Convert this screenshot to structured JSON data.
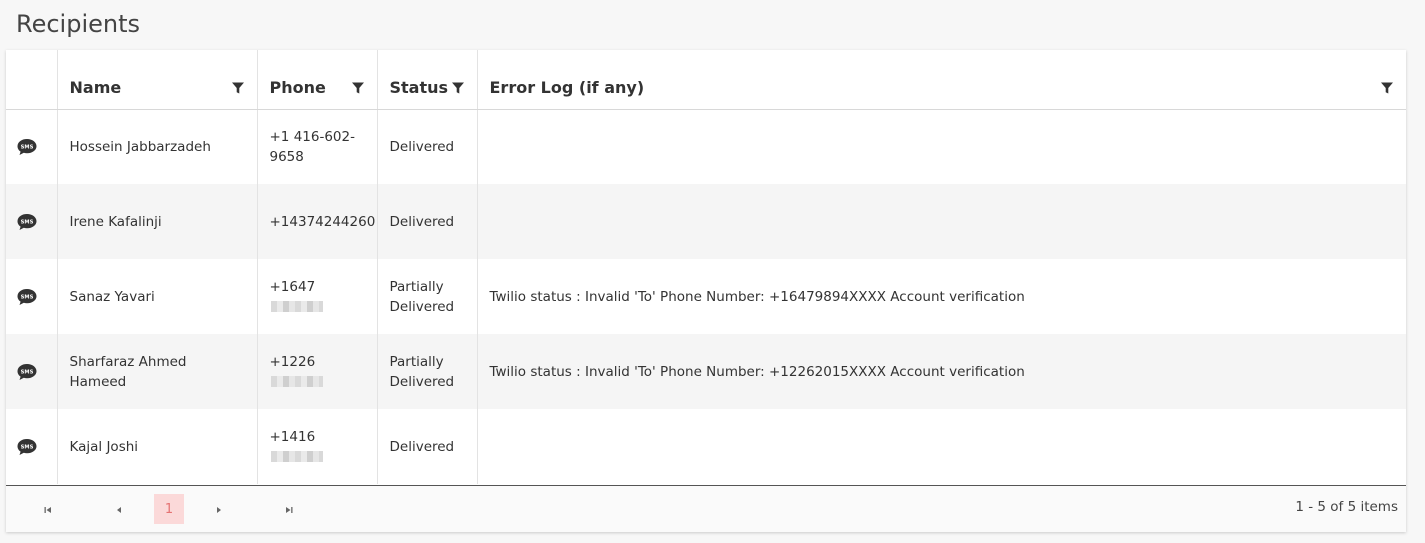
{
  "page": {
    "title": "Recipients"
  },
  "columns": [
    {
      "label": ""
    },
    {
      "label": "Name"
    },
    {
      "label": "Phone"
    },
    {
      "label": "Status"
    },
    {
      "label": "Error Log (if any)"
    }
  ],
  "rows": [
    {
      "channel_icon": "sms-icon",
      "name": "Hossein Jabbarzadeh",
      "phone": "+1 416-602-9658",
      "phone_redacted": false,
      "status": "Delivered",
      "error_log": ""
    },
    {
      "channel_icon": "sms-icon",
      "name": "Irene Kafalinji",
      "phone": "+14374244260",
      "phone_redacted": false,
      "status": "Delivered",
      "error_log": ""
    },
    {
      "channel_icon": "sms-icon",
      "name": "Sanaz Yavari",
      "phone": "+1647",
      "phone_redacted": true,
      "status": "Partially Delivered",
      "error_log": "Twilio status : Invalid 'To' Phone Number: +16479894XXXX Account verification"
    },
    {
      "channel_icon": "sms-icon",
      "name": "Sharfaraz Ahmed Hameed",
      "phone": "+1226",
      "phone_redacted": true,
      "status": "Partially Delivered",
      "error_log": "Twilio status : Invalid 'To' Phone Number: +12262015XXXX Account verification"
    },
    {
      "channel_icon": "sms-icon",
      "name": "Kajal Joshi",
      "phone": "+1416",
      "phone_redacted": true,
      "status": "Delivered",
      "error_log": ""
    }
  ],
  "pager": {
    "current_page": "1",
    "info": "1 - 5 of 5 items"
  },
  "colors": {
    "accent_page_bg": "#fbd9d9",
    "accent_page_text": "#e57373",
    "stripe": "#f5f5f5"
  }
}
